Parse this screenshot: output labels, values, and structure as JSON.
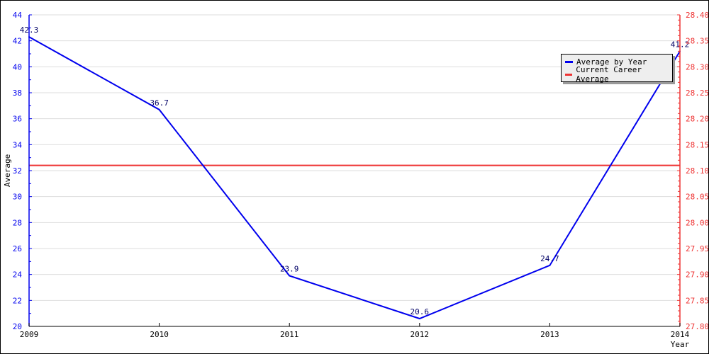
{
  "chart_data": {
    "type": "line",
    "title": "",
    "xlabel": "Year",
    "ylabel": "Average",
    "x": [
      2009,
      2010,
      2011,
      2012,
      2013,
      2014
    ],
    "x_tick_labels": [
      "2009",
      "2010",
      "2011",
      "2012",
      "2013",
      "2014"
    ],
    "ylim": [
      20,
      44
    ],
    "y_ticks": [
      20,
      22,
      24,
      26,
      28,
      30,
      32,
      34,
      36,
      38,
      40,
      42,
      44
    ],
    "y2lim": [
      27.8,
      28.4
    ],
    "y2_ticks": [
      "27.80",
      "27.85",
      "27.90",
      "27.95",
      "28.00",
      "28.05",
      "28.10",
      "28.15",
      "28.20",
      "28.25",
      "28.30",
      "28.35",
      "28.40"
    ],
    "grid": true,
    "legend_position": "top-right",
    "series": [
      {
        "name": "Average by Year",
        "axis": "left",
        "color": "#0000ee",
        "values": [
          42.3,
          36.7,
          23.9,
          20.6,
          24.7,
          41.2
        ],
        "labels": [
          "42.3",
          "36.7",
          "23.9",
          "20.6",
          "24.7",
          "41.2"
        ]
      },
      {
        "name": "Current Career Average",
        "axis": "right",
        "color": "#ee3333",
        "value": 28.11
      }
    ]
  }
}
